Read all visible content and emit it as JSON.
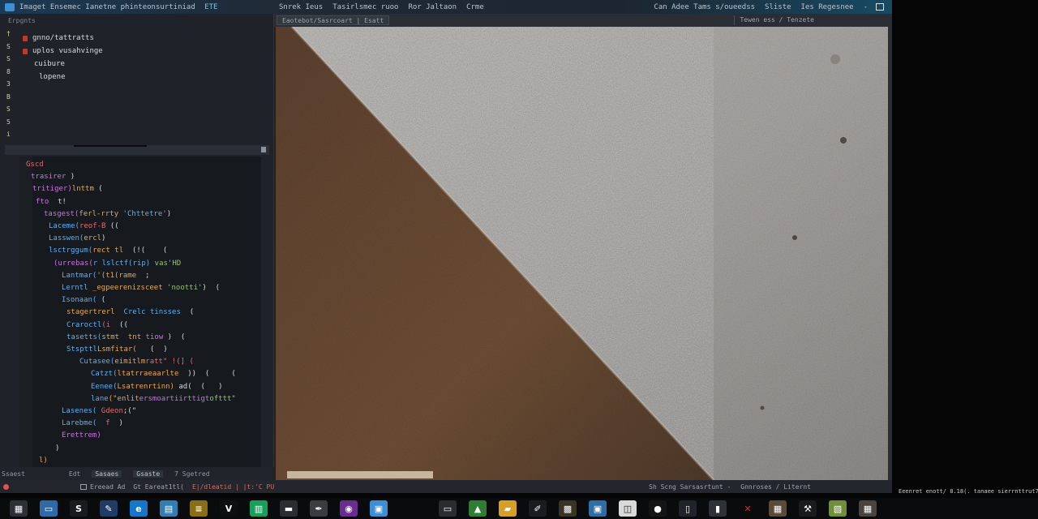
{
  "window": {
    "title": "Imaget Ensemec Ianetne phinteonsurtiniad",
    "title_tag": "ETE",
    "doc_menu": [
      "Snrek Ieus",
      "Tasirlsmec ruoo",
      "Ror Jaltaon",
      "Crme"
    ],
    "right_menu": [
      "Can Adee Tams s/oueedss",
      "Sliste",
      "Ies Regesnee",
      "-"
    ]
  },
  "sidebar": {
    "header": "Erpgnts",
    "gutter_top": [
      "†",
      "S",
      "S",
      "8",
      "3",
      "B",
      "S",
      "5",
      "i"
    ],
    "tree": [
      {
        "label": "gnno/tattratts",
        "level": 0
      },
      {
        "label": "uplos vusahvinge",
        "level": 0
      },
      {
        "label": "cuibure",
        "level": 1
      },
      {
        "label": "lopene",
        "level": 2
      }
    ]
  },
  "editor": {
    "lines": [
      [
        {
          "t": "Gscd",
          "c": "num"
        }
      ],
      [
        {
          "t": "trasirer ",
          "c": "kw"
        },
        {
          "t": ")",
          "c": "pl"
        }
      ],
      [
        {
          "t": "tritiger)",
          "c": "kw"
        },
        {
          "t": "lnttm",
          "c": "fn"
        },
        {
          "t": " (",
          "c": "pl"
        }
      ],
      [
        {
          "t": "fto",
          "c": "kw"
        },
        {
          "t": "  t!",
          "c": "pl"
        }
      ],
      [
        {
          "t": "tasgest(",
          "c": "kw"
        },
        {
          "t": "ferl-rrty",
          "c": "fn"
        },
        {
          "t": " 'Chttetre'",
          "c": "id"
        },
        {
          "t": ")",
          "c": "pl"
        }
      ],
      [
        {
          "t": "Laceme(",
          "c": "id"
        },
        {
          "t": "reof-B",
          "c": "num"
        },
        {
          "t": " ((",
          "c": "pl"
        }
      ],
      [
        {
          "t": "Lasswen(",
          "c": "id"
        },
        {
          "t": "ercl",
          "c": "fn"
        },
        {
          "t": ")",
          "c": "pl"
        }
      ],
      [
        {
          "t": "lsctrggum(",
          "c": "id"
        },
        {
          "t": "rect tl",
          "c": "fn"
        },
        {
          "t": "  (!(    (",
          "c": "pl"
        }
      ],
      [
        {
          "t": "(urrebas(",
          "c": "kw"
        },
        {
          "t": "r lslctf(rip)",
          "c": "id"
        },
        {
          "t": " vas'HD",
          "c": "str"
        }
      ],
      [
        {
          "t": "Lantmar(",
          "c": "id"
        },
        {
          "t": "'(t1(rame",
          "c": "fn"
        },
        {
          "t": "  ;",
          "c": "pl"
        }
      ],
      [
        {
          "t": "Lerntl ",
          "c": "id"
        },
        {
          "t": "_egpeerenizsceet",
          "c": "fn"
        },
        {
          "t": " 'nootti'",
          "c": "str"
        },
        {
          "t": ")  (",
          "c": "pl"
        }
      ],
      [
        {
          "t": "Isonaan(",
          "c": "id"
        },
        {
          "t": " (",
          "c": "pl"
        }
      ],
      [
        {
          "t": "stagertrerl",
          "c": "fn"
        },
        {
          "t": "  Crelc tinsses",
          "c": "id"
        },
        {
          "t": "  (",
          "c": "pl"
        }
      ],
      [
        {
          "t": "Craroctl",
          "c": "id"
        },
        {
          "t": "(i",
          "c": "num"
        },
        {
          "t": "  ((",
          "c": "pl"
        }
      ],
      [
        {
          "t": "tasetts(",
          "c": "id"
        },
        {
          "t": "stmt  tnt",
          "c": "fn"
        },
        {
          "t": " tiow",
          "c": "kw"
        },
        {
          "t": " )  (",
          "c": "pl"
        }
      ],
      [
        {
          "t": "Stspttl",
          "c": "id"
        },
        {
          "t": "Lsmfitar(",
          "c": "fn"
        },
        {
          "t": "   (  )",
          "c": "pl"
        }
      ],
      [
        {
          "t": "Cutasee(",
          "c": "id"
        },
        {
          "t": "eimitlm",
          "c": "fn"
        },
        {
          "t": "ratt\" !(] (",
          "c": "num"
        }
      ],
      [
        {
          "t": "Catzt(",
          "c": "id"
        },
        {
          "t": "ltatrraeaarlte",
          "c": "fn"
        },
        {
          "t": "  ))  (     (",
          "c": "pl"
        }
      ],
      [
        {
          "t": "Eenee(",
          "c": "id"
        },
        {
          "t": "Lsatrenrtinn)",
          "c": "fn"
        },
        {
          "t": " ad(  (   )",
          "c": "pl"
        }
      ],
      [
        {
          "t": "lane",
          "c": "id"
        },
        {
          "t": "(\"enlit",
          "c": "fn"
        },
        {
          "t": "ersmoartiirttigt",
          "c": "kw"
        },
        {
          "t": "ofttt\"",
          "c": "str"
        }
      ],
      [
        {
          "t": "Lasenes(",
          "c": "id"
        },
        {
          "t": " Gdeon",
          "c": "num"
        },
        {
          "t": ";(\"",
          "c": "pl"
        }
      ],
      [
        {
          "t": "Larebme(",
          "c": "id"
        },
        {
          "t": "  f",
          "c": "num"
        },
        {
          "t": "  )",
          "c": "pl"
        }
      ],
      [
        {
          "t": "Erettrem)",
          "c": "kw"
        }
      ],
      [
        {
          "t": ")",
          "c": "pl"
        }
      ],
      [
        {
          "t": "l)",
          "c": "fn"
        }
      ]
    ]
  },
  "left_status": [
    "Ssaest",
    "Edt",
    "Sasaes",
    "Gsaste",
    "7  Sgetred"
  ],
  "tabbar": {
    "tab": "Eaotebot/Sasrcoart  | Esatt",
    "right": "Tewen ess / Tenzete"
  },
  "canvas": {
    "colors": {
      "concrete": "#a9a7a4",
      "soil": "#6a4a32",
      "edge": "#d8cfbf"
    }
  },
  "statusbar": {
    "segments": [
      "Ereead Ad",
      "Gt Eareat1tl(",
      "E|/dleatid | |t:'C PU"
    ],
    "right": [
      "Sh   Scng  Sarsasrtunt  -",
      "Gnnroses  /  Liternt"
    ]
  },
  "right_note": "Eeenret enott/ 8.18(.  tanaee sierrnttrut7ieiin",
  "taskbar": {
    "left_icons": [
      {
        "name": "grid-icon",
        "bg": "#2c2f36",
        "glyph": "▦"
      },
      {
        "name": "window-icon",
        "bg": "#2d6aa8",
        "glyph": "▭"
      },
      {
        "name": "quote-icon",
        "bg": "#1a1b1f",
        "glyph": "S"
      },
      {
        "name": "brush-icon",
        "bg": "#1f3b66",
        "glyph": "✎"
      },
      {
        "name": "browser-icon",
        "bg": "#1676c9",
        "glyph": "e"
      },
      {
        "name": "gallery-icon",
        "bg": "#2f7fb5",
        "glyph": "▤"
      },
      {
        "name": "notes-icon",
        "bg": "#8a6d17",
        "glyph": "≡"
      },
      {
        "name": "vim-icon",
        "bg": "#0e0f11",
        "glyph": "V"
      },
      {
        "name": "sheet-icon",
        "bg": "#18a05a",
        "glyph": "▥"
      },
      {
        "name": "terminal-icon",
        "bg": "#2b2d30",
        "glyph": "▬"
      },
      {
        "name": "pen-icon",
        "bg": "#3a3c40",
        "glyph": "✒"
      },
      {
        "name": "media-icon",
        "bg": "#6a2c8f",
        "glyph": "◉"
      },
      {
        "name": "photo-icon",
        "bg": "#3b8fd8",
        "glyph": "▣"
      }
    ],
    "right_icons": [
      {
        "name": "display-icon",
        "bg": "#2a2c30",
        "glyph": "▭"
      },
      {
        "name": "image-icon",
        "bg": "#2e7d32",
        "glyph": "▲"
      },
      {
        "name": "folder-icon",
        "bg": "#d6a024",
        "glyph": "▰"
      },
      {
        "name": "draw-icon",
        "bg": "#1b1c1f",
        "glyph": "✐"
      },
      {
        "name": "pattern-icon",
        "bg": "#3a3326",
        "glyph": "▩"
      },
      {
        "name": "monitor-icon",
        "bg": "#2c6ea5",
        "glyph": "▣"
      },
      {
        "name": "scan-icon",
        "bg": "#d9d9d9",
        "glyph": "◫"
      },
      {
        "name": "camera-icon",
        "bg": "#151515",
        "glyph": "●"
      },
      {
        "name": "phone-icon",
        "bg": "#20242a",
        "glyph": "▯"
      },
      {
        "name": "tablet-icon",
        "bg": "#2e3238",
        "glyph": "▮"
      },
      {
        "name": "x-icon",
        "bg": "#0a0b0d",
        "glyph": "✕"
      },
      {
        "name": "thumb-icon",
        "bg": "#5a4a3a",
        "glyph": "▦"
      },
      {
        "name": "tools-icon",
        "bg": "#1a1b1d",
        "glyph": "⚒"
      },
      {
        "name": "chart-icon",
        "bg": "#6f8f3a",
        "glyph": "▧"
      },
      {
        "name": "texture-icon",
        "bg": "#4a4440",
        "glyph": "▦"
      }
    ]
  }
}
